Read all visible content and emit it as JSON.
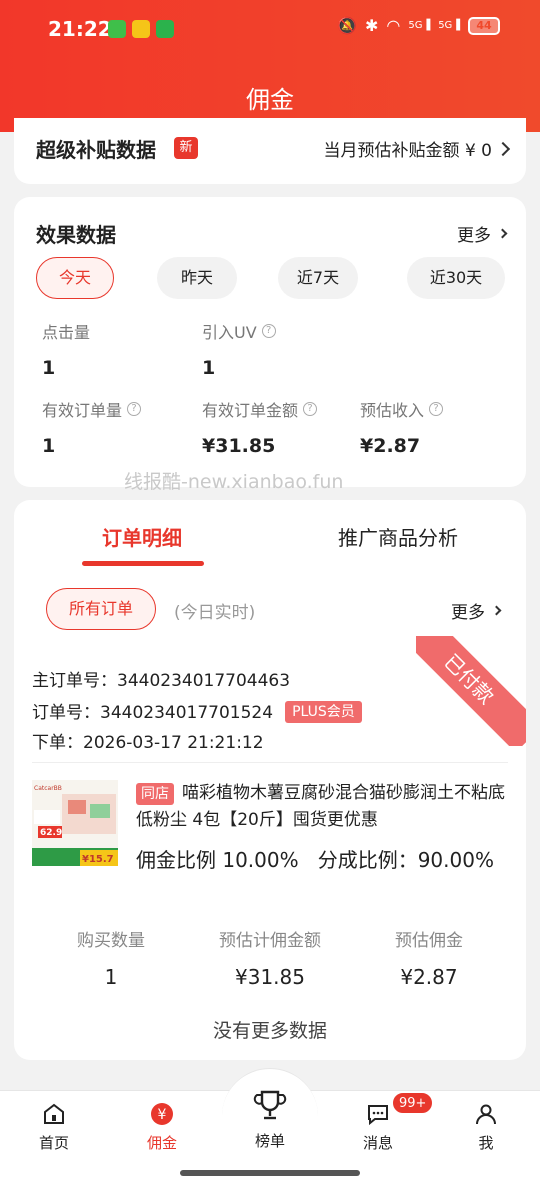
{
  "status_bar": {
    "time": "21:22",
    "battery": "44"
  },
  "header": {
    "title": "佣金"
  },
  "subsidy": {
    "title": "超级补贴数据",
    "badge": "新",
    "right_text": "当月预估补贴金额 ¥ 0"
  },
  "effect": {
    "title": "效果数据",
    "more": "更多",
    "ranges": [
      "今天",
      "昨天",
      "近7天",
      "近30天"
    ],
    "selected_range": "今天",
    "metrics": [
      {
        "label": "点击量",
        "value": "1"
      },
      {
        "label": "引入UV",
        "value": "1"
      },
      {
        "label": "有效订单量",
        "value": "1"
      },
      {
        "label": "有效订单金额",
        "value": "¥31.85"
      },
      {
        "label": "预估收入",
        "value": "¥2.87"
      }
    ]
  },
  "watermark": "线报酷-new.xianbao.fun",
  "orders": {
    "tabs": [
      "订单明细",
      "推广商品分析"
    ],
    "active_tab": "订单明细",
    "filter": "所有订单",
    "filter_note": "(今日实时)",
    "more": "更多",
    "status_ribbon": "已付款",
    "main_order_no": "主订单号：3440234017704463",
    "order_no": "订单号：3440234017701524",
    "plus_badge": "PLUS会员",
    "order_time": "下单：2026-03-17 21:21:12",
    "store_tag": "同店",
    "product_title": "喵彩植物木薯豆腐砂混合猫砂膨润土不粘底低粉尘 4包【20斤】囤货更优惠",
    "commission_ratio": "佣金比例 10.00%",
    "split_ratio": "分成比例：90.00%",
    "product_image_text": {
      "brand": "CatcarBB",
      "price1": "62.9",
      "price2": "¥15.7"
    },
    "stats": [
      {
        "label": "购买数量",
        "value": "1"
      },
      {
        "label": "预估计佣金额",
        "value": "¥31.85"
      },
      {
        "label": "预估佣金",
        "value": "¥2.87"
      }
    ],
    "no_more": "没有更多数据"
  },
  "nav": {
    "items": [
      {
        "label": "首页"
      },
      {
        "label": "佣金"
      },
      {
        "label": "榜单"
      },
      {
        "label": "消息"
      },
      {
        "label": "我"
      }
    ],
    "active": "佣金",
    "message_badge": "99+"
  },
  "colors": {
    "accent": "#e8372c",
    "header": "#f2372a",
    "ribbon": "#f06b6b"
  }
}
